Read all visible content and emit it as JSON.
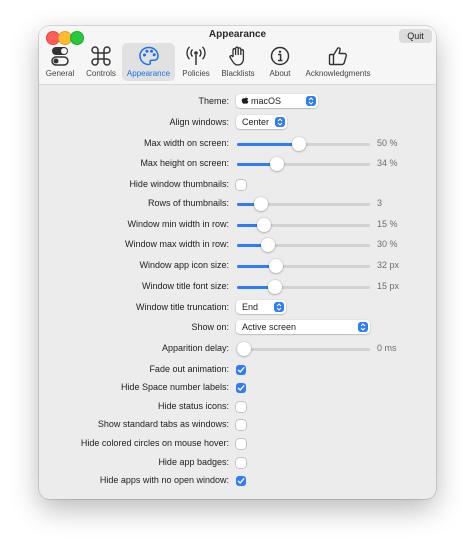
{
  "window": {
    "title": "Appearance",
    "quit_label": "Quit"
  },
  "tabs": [
    {
      "label": "General",
      "icon": "toggle-icon"
    },
    {
      "label": "Controls",
      "icon": "command-icon"
    },
    {
      "label": "Appearance",
      "icon": "palette-icon",
      "active": true
    },
    {
      "label": "Policies",
      "icon": "antenna-icon"
    },
    {
      "label": "Blacklists",
      "icon": "hand-icon"
    },
    {
      "label": "About",
      "icon": "info-icon"
    },
    {
      "label": "Acknowledgments",
      "icon": "thumbs-up-icon"
    }
  ],
  "settings": {
    "theme": {
      "label": "Theme:",
      "value": "macOS"
    },
    "align_windows": {
      "label": "Align windows:",
      "value": "Center"
    },
    "max_width": {
      "label": "Max width on screen:",
      "value": "50 %",
      "fraction": 0.46
    },
    "max_height": {
      "label": "Max height on screen:",
      "value": "34 %",
      "fraction": 0.28
    },
    "hide_thumbnails": {
      "label": "Hide window thumbnails:",
      "checked": false
    },
    "rows_thumbnails": {
      "label": "Rows of thumbnails:",
      "value": "3",
      "fraction": 0.14
    },
    "min_width_row": {
      "label": "Window min width in row:",
      "value": "15 %",
      "fraction": 0.17
    },
    "max_width_row": {
      "label": "Window max width in row:",
      "value": "30 %",
      "fraction": 0.2
    },
    "app_icon_size": {
      "label": "Window app icon size:",
      "value": "32 px",
      "fraction": 0.27
    },
    "title_font_size": {
      "label": "Window title font size:",
      "value": "15 px",
      "fraction": 0.26
    },
    "title_truncation": {
      "label": "Window title truncation:",
      "value": "End"
    },
    "show_on": {
      "label": "Show on:",
      "value": "Active screen"
    },
    "apparition_delay": {
      "label": "Apparition delay:",
      "value": "0 ms",
      "fraction": 0.0
    },
    "fade_out": {
      "label": "Fade out animation:",
      "checked": true
    },
    "hide_space_labels": {
      "label": "Hide Space number labels:",
      "checked": true
    },
    "hide_status_icons": {
      "label": "Hide status icons:",
      "checked": false
    },
    "show_standard_tabs": {
      "label": "Show standard tabs as windows:",
      "checked": false
    },
    "hide_colored_circles": {
      "label": "Hide colored circles on mouse hover:",
      "checked": false
    },
    "hide_app_badges": {
      "label": "Hide app badges:",
      "checked": false
    },
    "hide_apps_no_window": {
      "label": "Hide apps with no open window:",
      "checked": true
    }
  },
  "colors": {
    "accent": "#2e7cf6",
    "window_bg": "#ececec",
    "toolbar_bg": "#f6f6f6"
  }
}
